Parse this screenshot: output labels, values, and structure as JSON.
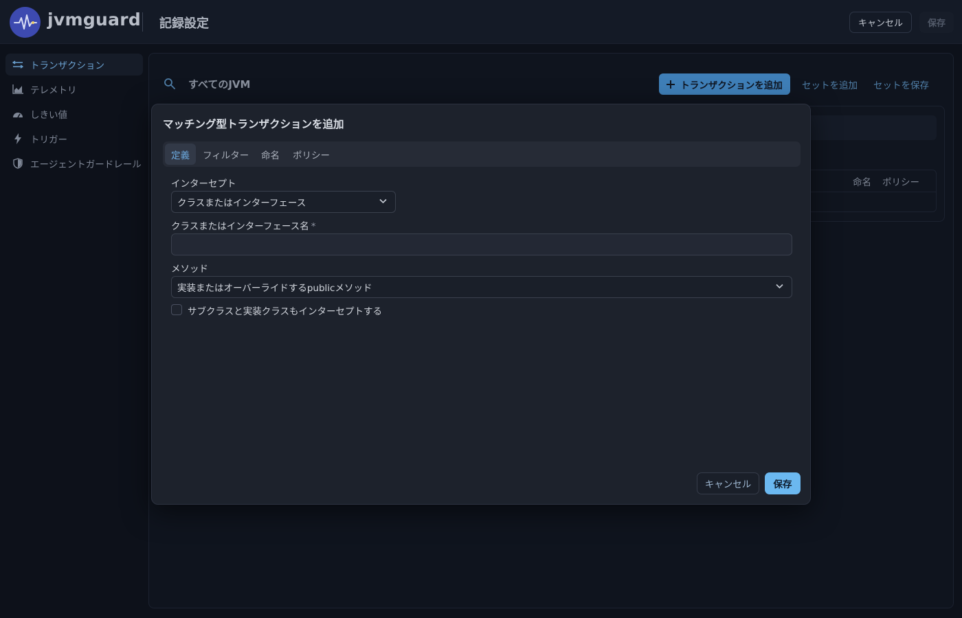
{
  "header": {
    "brand": "jvmguard",
    "title": "記録設定",
    "cancel_label": "キャンセル",
    "save_label": "保存"
  },
  "sidebar": {
    "items": [
      {
        "label": "トランザクション",
        "icon": "transactions-icon",
        "active": true
      },
      {
        "label": "テレメトリ",
        "icon": "chart-icon",
        "active": false
      },
      {
        "label": "しきい値",
        "icon": "gauge-icon",
        "active": false
      },
      {
        "label": "トリガー",
        "icon": "bolt-icon",
        "active": false
      },
      {
        "label": "エージェントガードレール",
        "icon": "shield-icon",
        "active": false
      }
    ]
  },
  "main": {
    "scope_label": "すべてのJVM",
    "add_transaction_label": "トランザクションを追加",
    "add_set_label": "セットを追加",
    "save_set_label": "セットを保存",
    "table_columns": [
      "命名",
      "ポリシー"
    ]
  },
  "dialog": {
    "title": "マッチング型トランザクションを追加",
    "tabs": [
      {
        "label": "定義",
        "active": true
      },
      {
        "label": "フィルター",
        "active": false
      },
      {
        "label": "命名",
        "active": false
      },
      {
        "label": "ポリシー",
        "active": false
      }
    ],
    "intercept_label": "インターセプト",
    "intercept_value": "クラスまたはインターフェース",
    "class_name_label": "クラスまたはインターフェース名",
    "class_name_required_mark": "*",
    "class_name_value": "",
    "method_label": "メソッド",
    "method_value": "実装またはオーバーライドするpublicメソッド",
    "subclass_checkbox_label": "サブクラスと実装クラスもインターセプトする",
    "subclass_checked": false,
    "cancel_label": "キャンセル",
    "save_label": "保存"
  },
  "colors": {
    "accent": "#6bb8f0",
    "primary_button": "#3f7fb8",
    "logo_bg": "#3d4ab0",
    "background": "#0d111a"
  }
}
